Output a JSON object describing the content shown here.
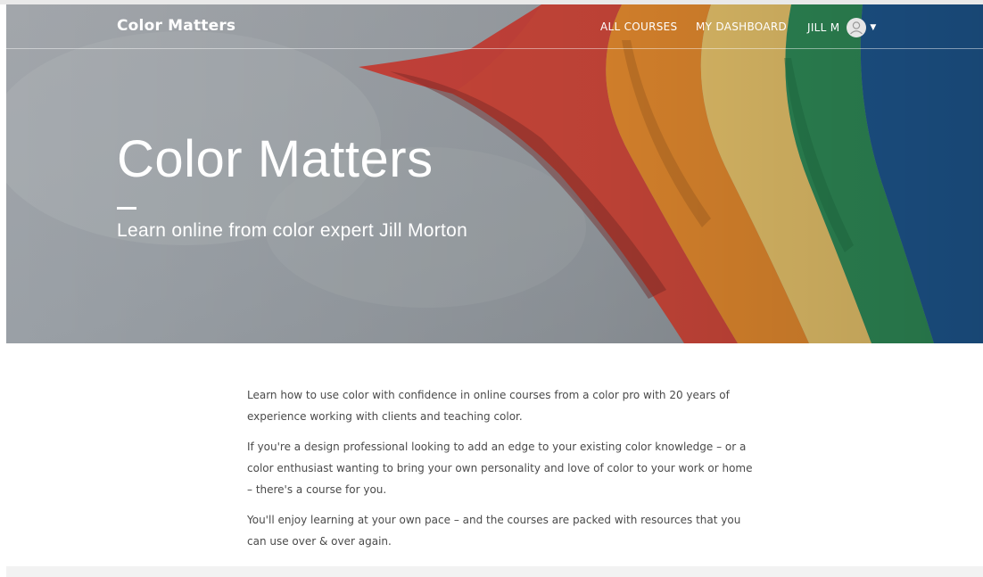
{
  "nav": {
    "brand": "Color Matters",
    "all_courses": "ALL COURSES",
    "my_dashboard": "MY DASHBOARD",
    "user_name": "JILL M"
  },
  "hero": {
    "title": "Color Matters",
    "subtitle": "Learn online from color expert Jill Morton"
  },
  "content": {
    "paragraphs": [
      "Learn how to use color with confidence in online courses from a color pro with 20 years of experience working with clients and teaching color.",
      "If you're a design professional looking to add an edge to your existing color knowledge – or a color enthusiast wanting to bring your own personality and love of color to your work or home – there's a course for you.",
      "You'll enjoy learning at your own pace – and the courses are packed with resources that you can use over & over again."
    ]
  },
  "icons": {
    "avatar": "user-avatar-icon",
    "caret": "caret-down-icon"
  },
  "colors": {
    "hero_gray": "#9ea3a8",
    "flag_red": "#d0463a",
    "flag_orange": "#e3892c",
    "flag_yellow": "#e8c66a",
    "flag_green": "#2c8a55",
    "flag_blue": "#1f5a93",
    "body_text": "#4a4a4a"
  }
}
